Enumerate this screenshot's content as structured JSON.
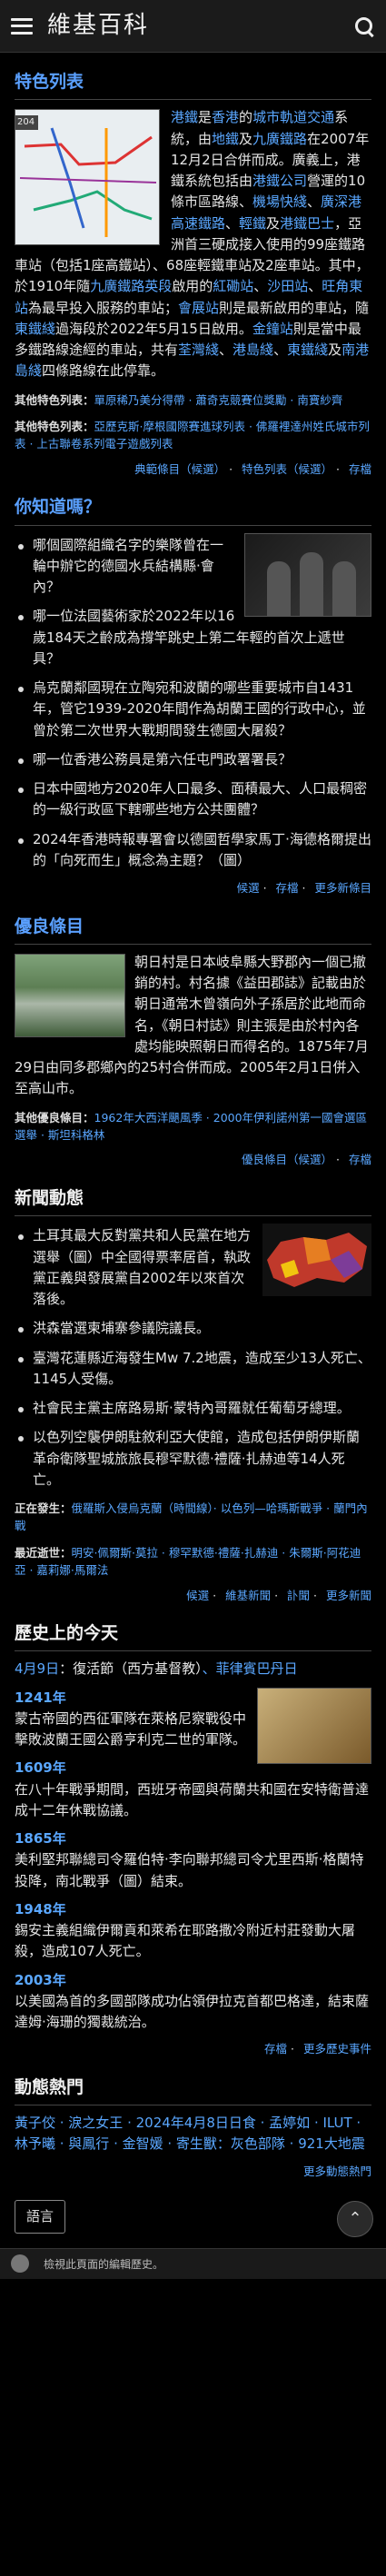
{
  "header": {
    "logo": "維基百科"
  },
  "featured": {
    "title": "特色列表",
    "map_label": "204",
    "p1_a": "港鐵",
    "p1_b": "是",
    "p1_c": "香港",
    "p1_d": "的",
    "p1_e": "城市軌道交通",
    "p1_f": "系統，由",
    "p1_g": "地鐵",
    "p1_h": "及",
    "p1_i": "九廣鐵路",
    "p1_j": "在2007年12月2日合併而成。廣義上，港鐵系統包括由",
    "p1_k": "港鐵公司",
    "p1_l": "營運的10條市區路線、",
    "p1_m": "機場快綫",
    "p1_n": "、",
    "p1_o": "廣深港高速鐵路",
    "p1_p": "、",
    "p1_q": "輕鐵",
    "p1_r": "及",
    "p1_s": "港鐵巴士",
    "p1_t": "，亞洲首三硬成接入使用的99座鐵路車站（包括1座高鐵站）、68座輕鐵車站及2座車站。其中，於1910年隨",
    "p1_u": "九廣鐵路英段",
    "p1_v": "啟用的",
    "p1_w": "紅磡站",
    "p1_x": "、",
    "p1_y": "沙田站",
    "p1_z": "、",
    "p1_aa": "旺角東站",
    "p1_ab": "為最早投入服務的車站；",
    "p1_ac": "會展站",
    "p1_ad": "則是最新啟用的車站，隨",
    "p1_ae": "東鐵綫",
    "p1_af": "過海段於2022年5月15日啟用。",
    "p1_ag": "金鐘站",
    "p1_ah": "則是當中最多鐵路線途經的車站，共有",
    "p1_ai": "荃灣綫",
    "p1_aj": "、",
    "p1_ak": "港島綫",
    "p1_al": "、",
    "p1_am": "東鐵綫",
    "p1_an": "及",
    "p1_ao": "南港島綫",
    "p1_ap": "四條路線在此停靠。",
    "meta1_label": "其他特色列表：",
    "meta1_text": "單原稀乃美分得帶 · 蕭奇克競賽位獎勵 · 南寶紗齊",
    "meta2_label": "其他特色列表：",
    "meta2_text": "亞歷克斯·摩根國際賽進球列表 · 佛羅裡達州姓氏城市列表 · 上古聯卷系列電子遊戲列表",
    "links": [
      "典範條目（候選）",
      "特色列表（候選）",
      "存檔"
    ]
  },
  "dyk": {
    "title": "你知道嗎？",
    "items": [
      "哪個國際組織名字的樂隊曾在一輪中辦它的德國水兵結構縣·會內？",
      "哪一位法國藝術家於2022年以16歲184天之齡成為撐竿跳史上第二年輕的首次上遞世具？",
      "烏克蘭鄰國現在立陶宛和波蘭的哪些重要城市自1431年，管它1939-2020年間作為胡蘭王國的行政中心，並曾於第二次世界大戰期間發生德國大屠殺？",
      "哪一位香港公務員是第六任屯門政署署長？",
      "日本中國地方2020年人口最多、面積最大、人口最稠密的一級行政區下轄哪些地方公共團體？",
      "2024年香港時報專署會以德國哲學家馬丁·海德格爾提出的「向死而生」概念為主題？（圖）"
    ],
    "links": [
      "候選",
      "存檔",
      "更多新條目"
    ]
  },
  "good": {
    "title": "優良條目",
    "p1": "朝日村是日本岐阜縣大野郡內一個已撤銷的村。村名據《益田郡誌》記載由於朝日通常木曾嶺向外子孫居於此地而命名，《朝日村誌》則主張是由於村內各處均能映照朝日而得名的。1875年7月29日由同多郡鄉內的25村合併而成。2005年2月1日併入至高山市。",
    "meta_label": "其他優良條目：",
    "meta_text": "1962年大西洋颶風季 · 2000年伊利諾州第一國會選區選舉 · 斯坦科格林",
    "links": [
      "優良條目（候選）",
      "存檔"
    ]
  },
  "news": {
    "title": "新聞動態",
    "items": [
      "土耳其最大反對黨共和人民黨在地方選舉（圖）中全國得票率居首，執政黨正義與發展黨自2002年以來首次落後。",
      "洪森當選柬埔寨參議院議長。",
      "臺灣花蓮縣近海發生Mw 7.2地震，造成至少13人死亡、1145人受傷。",
      "社會民主黨主席路易斯·蒙特內哥羅就任葡萄牙總理。",
      "以色列空襲伊朗駐敘利亞大使館，造成包括伊朗伊斯蘭革命衛隊聖城旅旅長穆罕默德·禮薩·扎赫迪等14人死亡。"
    ],
    "ongoing_label": "正在發生：",
    "ongoing_text": "俄羅斯入侵烏克蘭（時間線）· 以色列—哈瑪斯戰爭 · 蘭門內戰",
    "deaths_label": "最近逝世：",
    "deaths_text": "明安·佩爾斯·莫拉 · 穆罕默德·禮薩·扎赫迪 · 朱爾斯·阿花迪亞 · 嘉莉娜·馬爾法",
    "links": [
      "候選",
      "維基新聞",
      "訃聞",
      "更多新聞"
    ]
  },
  "history": {
    "title": "歷史上的今天",
    "date_line_a": "4月9日",
    "date_line_b": "：復活節（西方基督教）",
    "date_line_c": "、菲律賓巴丹日",
    "events": [
      {
        "year": "1241年",
        "text": "蒙古帝國的西征軍隊在萊格尼察戰役中擊敗波蘭王國公爵亨利克二世的軍隊。"
      },
      {
        "year": "1609年",
        "text": "在八十年戰爭期間，西班牙帝國與荷蘭共和國在安特衛普達成十二年休戰協議。"
      },
      {
        "year": "1865年",
        "text": "美利堅邦聯總司令羅伯特·李向聯邦總司令尤里西斯·格蘭特投降，南北戰爭（圖）結束。"
      },
      {
        "year": "1948年",
        "text": "錫安主義組織伊爾貢和萊希在耶路撒冷附近村莊發動大屠殺，造成107人死亡。"
      },
      {
        "year": "2003年",
        "text": "以美國為首的多國部隊成功佔領伊拉克首都巴格達，結束薩達姆·海珊的獨裁統治。"
      }
    ],
    "links": [
      "存檔",
      "更多歷史事件"
    ]
  },
  "trending": {
    "title": "動態熱門",
    "text": "黃子佼 · 淚之女王 · 2024年4月8日日食 · 孟婷如 · ILUT · 林予曦 · 與鳳行 · 金智媛 · 寄生獸：灰色部隊 · 921大地震",
    "more": "更多動態熱門"
  },
  "footer": {
    "language_button": "語言",
    "bottom_text": "檢視此頁面的編輯歷史。"
  }
}
